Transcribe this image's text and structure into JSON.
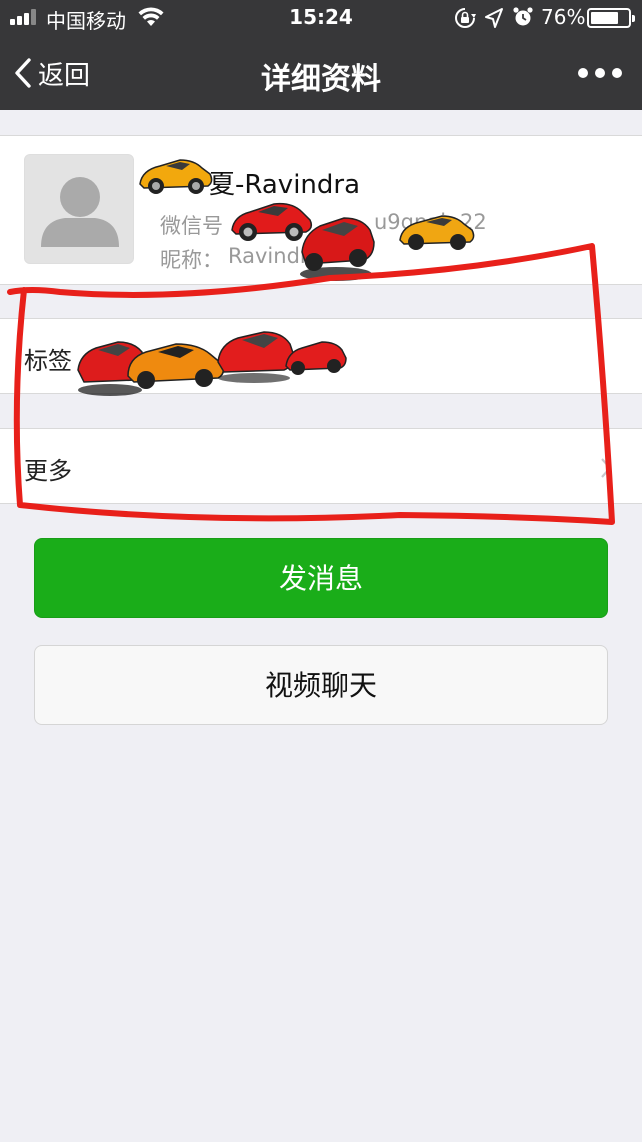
{
  "status_bar": {
    "carrier": "中国移动",
    "time": "15:24",
    "battery_percent": "76%",
    "battery_level": 0.76
  },
  "nav": {
    "back_label": "返回",
    "title": "详细资料"
  },
  "profile": {
    "name_visible": "夏-Ravindra",
    "wechat_id_label": "微信号",
    "wechat_id_fragment_1": "u9gpai",
    "wechat_id_fragment_2": "22",
    "nickname_label": "昵称：",
    "nickname_visible": "Ravindr"
  },
  "rows": {
    "tags_label": "标签",
    "more_label": "更多"
  },
  "buttons": {
    "send_message": "发消息",
    "video_call": "视频聊天"
  },
  "colors": {
    "nav_bg": "#373739",
    "accent_green": "#1aad19",
    "annotation_red": "#e8201a"
  }
}
